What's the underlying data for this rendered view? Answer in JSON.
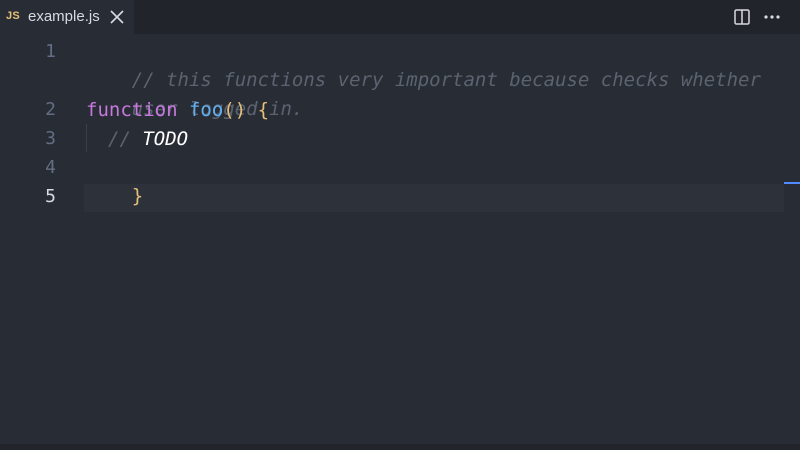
{
  "tab": {
    "lang_badge": "JS",
    "file_name": "example.js"
  },
  "toolbar": {
    "icons": [
      "split-editor-icon",
      "more-actions-icon"
    ]
  },
  "editor": {
    "gutter": [
      "1",
      "2",
      "3",
      "4",
      "5"
    ],
    "active_line": "5",
    "lines": {
      "l1a": "// this functions very important because checks whether",
      "l1b": "user logged in.",
      "l2_keyword": "function",
      "l2_space": " ",
      "l2_name": "foo",
      "l2_parens": "()",
      "l2_space2": " ",
      "l2_brace": "{",
      "l3_comment": "// ",
      "l3_todo": "TODO",
      "l4_brace": "}"
    }
  },
  "colors": {
    "background": "#282c34",
    "tabbar": "#21252b",
    "comment": "#5c6370",
    "keyword": "#c678dd",
    "function": "#61afef",
    "bracket": "#e5c07b",
    "line_number": "#636d83",
    "accent": "#528bff"
  }
}
